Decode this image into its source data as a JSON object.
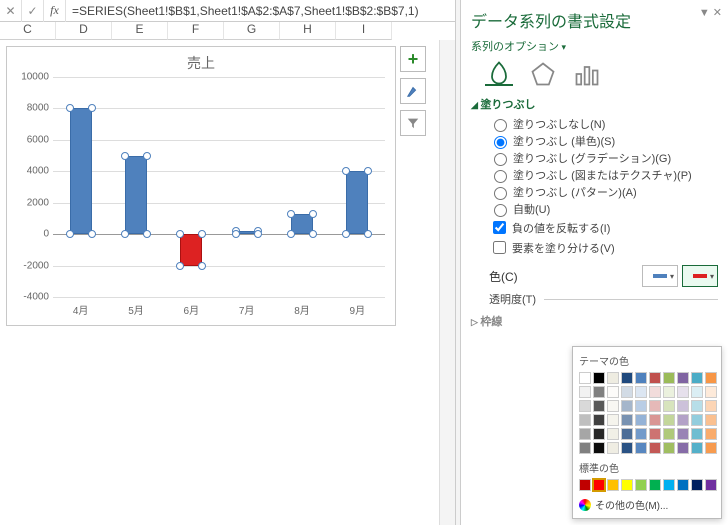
{
  "formula": "=SERIES(Sheet1!$B$1,Sheet1!$A$2:$A$7,Sheet1!$B$2:$B$7,1)",
  "columns": [
    "C",
    "D",
    "E",
    "F",
    "G",
    "H",
    "I"
  ],
  "chart": {
    "title": "売上",
    "y_ticks": [
      10000,
      8000,
      6000,
      4000,
      2000,
      0,
      -2000,
      -4000
    ],
    "x_labels": [
      "4月",
      "5月",
      "6月",
      "7月",
      "8月",
      "9月"
    ]
  },
  "chart_data": {
    "type": "bar",
    "categories": [
      "4月",
      "5月",
      "6月",
      "7月",
      "8月",
      "9月"
    ],
    "values": [
      8000,
      5000,
      -2000,
      200,
      1300,
      4000
    ],
    "title": "売上",
    "ylim": [
      -4000,
      10000
    ],
    "negative_color": "#d22",
    "positive_color": "#4f81bd"
  },
  "panel": {
    "title": "データ系列の書式設定",
    "series_options": "系列のオプション",
    "fill_section": "塗りつぶし",
    "fill_none": "塗りつぶしなし(N)",
    "fill_solid": "塗りつぶし (単色)(S)",
    "fill_grad": "塗りつぶし (グラデーション)(G)",
    "fill_tex": "塗りつぶし (図またはテクスチャ)(P)",
    "fill_pat": "塗りつぶし (パターン)(A)",
    "fill_auto": "自動(U)",
    "invert_neg": "負の値を反転する(I)",
    "vary_pt": "要素を塗り分ける(V)",
    "color_label": "色(C)",
    "trans_label": "透明度(T)",
    "border_section": "枠線",
    "popup": {
      "theme": "テーマの色",
      "standard": "標準の色",
      "more": "その他の色(M)..."
    }
  }
}
